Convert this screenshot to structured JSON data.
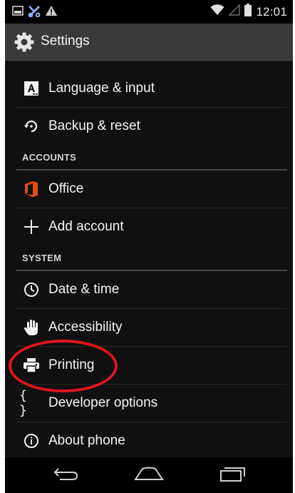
{
  "status_bar": {
    "time": "12:01",
    "left_icons": [
      "screenshot-icon",
      "tools-icon",
      "warning-icon"
    ],
    "right_icons": [
      "wifi-icon",
      "signal-icon",
      "battery-icon"
    ]
  },
  "action_bar": {
    "title": "Settings",
    "icon": "settings-gear-icon"
  },
  "settings": {
    "items": [
      {
        "label": "Language & input",
        "icon": "keyboard-icon"
      },
      {
        "label": "Backup & reset",
        "icon": "restore-icon"
      }
    ],
    "accounts": {
      "header": "ACCOUNTS",
      "items": [
        {
          "label": "Office",
          "icon": "office-icon"
        },
        {
          "label": "Add account",
          "icon": "plus-icon"
        }
      ]
    },
    "system": {
      "header": "SYSTEM",
      "items": [
        {
          "label": "Date & time",
          "icon": "clock-icon"
        },
        {
          "label": "Accessibility",
          "icon": "hand-icon"
        },
        {
          "label": "Printing",
          "icon": "printer-icon"
        },
        {
          "label": "Developer options",
          "icon": "braces-icon",
          "glyph": "{ }"
        },
        {
          "label": "About phone",
          "icon": "info-icon"
        }
      ]
    }
  },
  "nav_bar": {
    "buttons": [
      "back-icon",
      "home-icon",
      "recents-icon"
    ]
  },
  "annotation": {
    "highlighted_item": "Printing",
    "color": "#e0141b"
  },
  "colors": {
    "status_bar_bg": "#000000",
    "action_bar_bg": "#3a3a3a",
    "list_bg": "#101010",
    "office_orange": "#e64a19"
  }
}
